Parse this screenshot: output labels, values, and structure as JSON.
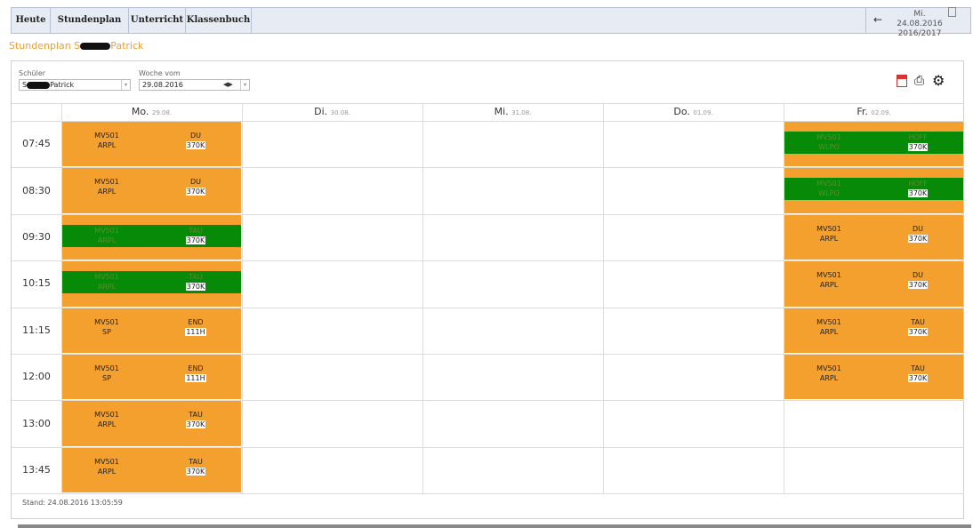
{
  "nav": {
    "tabs": [
      "Heute",
      "Stundenplan",
      "Unterricht",
      "Klassenbuch"
    ],
    "date_line1": "Mi. 24.08.2016",
    "date_line2": "2016/2017"
  },
  "page_title_prefix": "Stundenplan S",
  "page_title_suffix": "Patrick",
  "filters": {
    "schueler_label": "Schüler",
    "schueler_prefix": "S",
    "schueler_suffix": "Patrick",
    "woche_label": "Woche vom",
    "woche_value": "29.08.2016"
  },
  "days": [
    {
      "name": "Mo.",
      "date": "29.08."
    },
    {
      "name": "Di.",
      "date": "30.08."
    },
    {
      "name": "Mi.",
      "date": "31.08."
    },
    {
      "name": "Do.",
      "date": "01.09."
    },
    {
      "name": "Fr.",
      "date": "02.09."
    }
  ],
  "times": [
    "07:45",
    "08:30",
    "09:30",
    "10:15",
    "11:15",
    "12:00",
    "13:00",
    "13:45"
  ],
  "lessons": [
    {
      "day": 0,
      "slot": 0,
      "klasse": "MV501",
      "lehrer": "DU",
      "fach": "ARPL",
      "raum": "370K",
      "status": "normal"
    },
    {
      "day": 0,
      "slot": 1,
      "klasse": "MV501",
      "lehrer": "DU",
      "fach": "ARPL",
      "raum": "370K",
      "status": "normal"
    },
    {
      "day": 0,
      "slot": 2,
      "klasse": "MV501",
      "lehrer": "TAU",
      "fach": "ARPL",
      "raum": "370K",
      "status": "substituted"
    },
    {
      "day": 0,
      "slot": 3,
      "klasse": "MV501",
      "lehrer": "TAU",
      "fach": "ARPL",
      "raum": "370K",
      "status": "substituted"
    },
    {
      "day": 0,
      "slot": 4,
      "klasse": "MV501",
      "lehrer": "END",
      "fach": "SP",
      "raum": "111H",
      "status": "normal"
    },
    {
      "day": 0,
      "slot": 5,
      "klasse": "MV501",
      "lehrer": "END",
      "fach": "SP",
      "raum": "111H",
      "status": "normal"
    },
    {
      "day": 0,
      "slot": 6,
      "klasse": "MV501",
      "lehrer": "TAU",
      "fach": "ARPL",
      "raum": "370K",
      "status": "normal"
    },
    {
      "day": 0,
      "slot": 7,
      "klasse": "MV501",
      "lehrer": "TAU",
      "fach": "ARPL",
      "raum": "370K",
      "status": "normal"
    },
    {
      "day": 4,
      "slot": 0,
      "klasse": "MV501",
      "lehrer": "HOFF",
      "fach": "WLPO",
      "raum": "370K",
      "status": "substituted"
    },
    {
      "day": 4,
      "slot": 1,
      "klasse": "MV501",
      "lehrer": "HOFF",
      "fach": "WLPO",
      "raum": "370K",
      "status": "substituted"
    },
    {
      "day": 4,
      "slot": 2,
      "klasse": "MV501",
      "lehrer": "DU",
      "fach": "ARPL",
      "raum": "370K",
      "status": "normal"
    },
    {
      "day": 4,
      "slot": 3,
      "klasse": "MV501",
      "lehrer": "DU",
      "fach": "ARPL",
      "raum": "370K",
      "status": "normal"
    },
    {
      "day": 4,
      "slot": 4,
      "klasse": "MV501",
      "lehrer": "TAU",
      "fach": "ARPL",
      "raum": "370K",
      "status": "normal"
    },
    {
      "day": 4,
      "slot": 5,
      "klasse": "MV501",
      "lehrer": "TAU",
      "fach": "ARPL",
      "raum": "370K",
      "status": "normal"
    }
  ],
  "stand": "Stand: 24.08.2016 13:05:59",
  "colors": {
    "normal": "#f3a02e",
    "substituted": "#078a07",
    "title": "#f0a030"
  },
  "icons": [
    "arrow-left-icon",
    "calendar-icon",
    "print-icon",
    "gear-icon",
    "chevron-down-icon",
    "arrow-left-right-icon"
  ]
}
